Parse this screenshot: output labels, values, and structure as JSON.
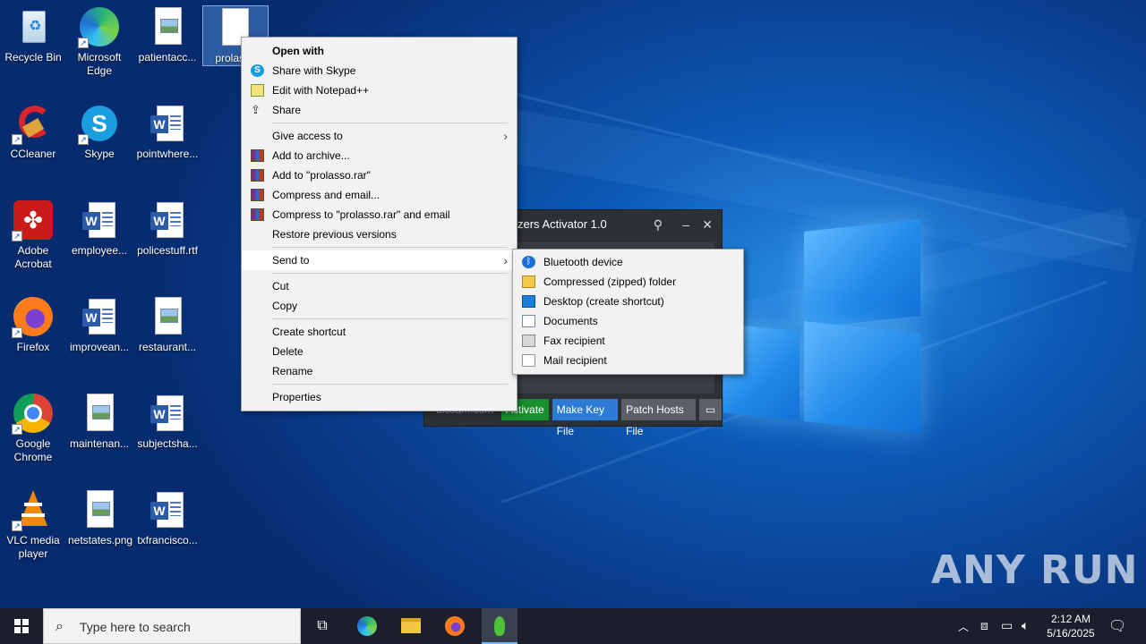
{
  "desktop": {
    "icons": [
      {
        "label": "Recycle Bin"
      },
      {
        "label": "Microsoft Edge"
      },
      {
        "label": "patientacc..."
      },
      {
        "label": "prolasso"
      },
      {
        "label": "CCleaner"
      },
      {
        "label": "Skype"
      },
      {
        "label": "pointwhere..."
      },
      {
        "label": "Adobe Acrobat"
      },
      {
        "label": "employee..."
      },
      {
        "label": "policestuff.rtf"
      },
      {
        "label": "Firefox"
      },
      {
        "label": "improvean..."
      },
      {
        "label": "restaurant..."
      },
      {
        "label": "Google Chrome"
      },
      {
        "label": "maintenan..."
      },
      {
        "label": "subjectsha..."
      },
      {
        "label": "VLC media player"
      },
      {
        "label": "netstates.png"
      },
      {
        "label": "txfrancisco..."
      }
    ]
  },
  "context_menu": {
    "items": [
      {
        "label": "Open with",
        "icon": ""
      },
      {
        "label": "Share with Skype",
        "icon": "skype-icon"
      },
      {
        "label": "Edit with Notepad++",
        "icon": "notepadpp-icon"
      },
      {
        "label": "Share",
        "icon": "share-icon"
      },
      {
        "label": "Give access to",
        "icon": ""
      },
      {
        "label": "Add to archive...",
        "icon": "winrar-icon"
      },
      {
        "label": "Add to \"prolasso.rar\"",
        "icon": "winrar-icon"
      },
      {
        "label": "Compress and email...",
        "icon": "winrar-icon"
      },
      {
        "label": "Compress to \"prolasso.rar\" and email",
        "icon": "winrar-icon"
      },
      {
        "label": "Restore previous versions",
        "icon": ""
      },
      {
        "label": "Send to",
        "icon": ""
      },
      {
        "label": "Cut",
        "icon": ""
      },
      {
        "label": "Copy",
        "icon": ""
      },
      {
        "label": "Create shortcut",
        "icon": ""
      },
      {
        "label": "Delete",
        "icon": ""
      },
      {
        "label": "Rename",
        "icon": ""
      },
      {
        "label": "Properties",
        "icon": ""
      }
    ]
  },
  "send_to_menu": {
    "items": [
      {
        "label": "Bluetooth device",
        "icon": "bluetooth-icon"
      },
      {
        "label": "Compressed (zipped) folder",
        "icon": "zip-folder-icon"
      },
      {
        "label": "Desktop (create shortcut)",
        "icon": "desktop-icon"
      },
      {
        "label": "Documents",
        "icon": "documents-icon"
      },
      {
        "label": "Fax recipient",
        "icon": "fax-icon"
      },
      {
        "label": "Mail recipient",
        "icon": "mail-icon"
      }
    ]
  },
  "activator": {
    "title": "zers Activator 1.0",
    "buttons": {
      "link": "bicsam.com",
      "activate": "Activate",
      "make_key": "Make Key File",
      "patch_hosts": "Patch Hosts File"
    }
  },
  "watermark": "ANY RUN",
  "taskbar": {
    "search_placeholder": "Type here to search",
    "time": "2:12 AM",
    "date": "5/16/2025"
  },
  "colors": {
    "desktop_bg": "#0a4a9e",
    "taskbar": "#1a1f2b",
    "activate_green": "#1a8f2e",
    "make_key_blue": "#2e7bd6",
    "patch_grey": "#5a5f68"
  }
}
